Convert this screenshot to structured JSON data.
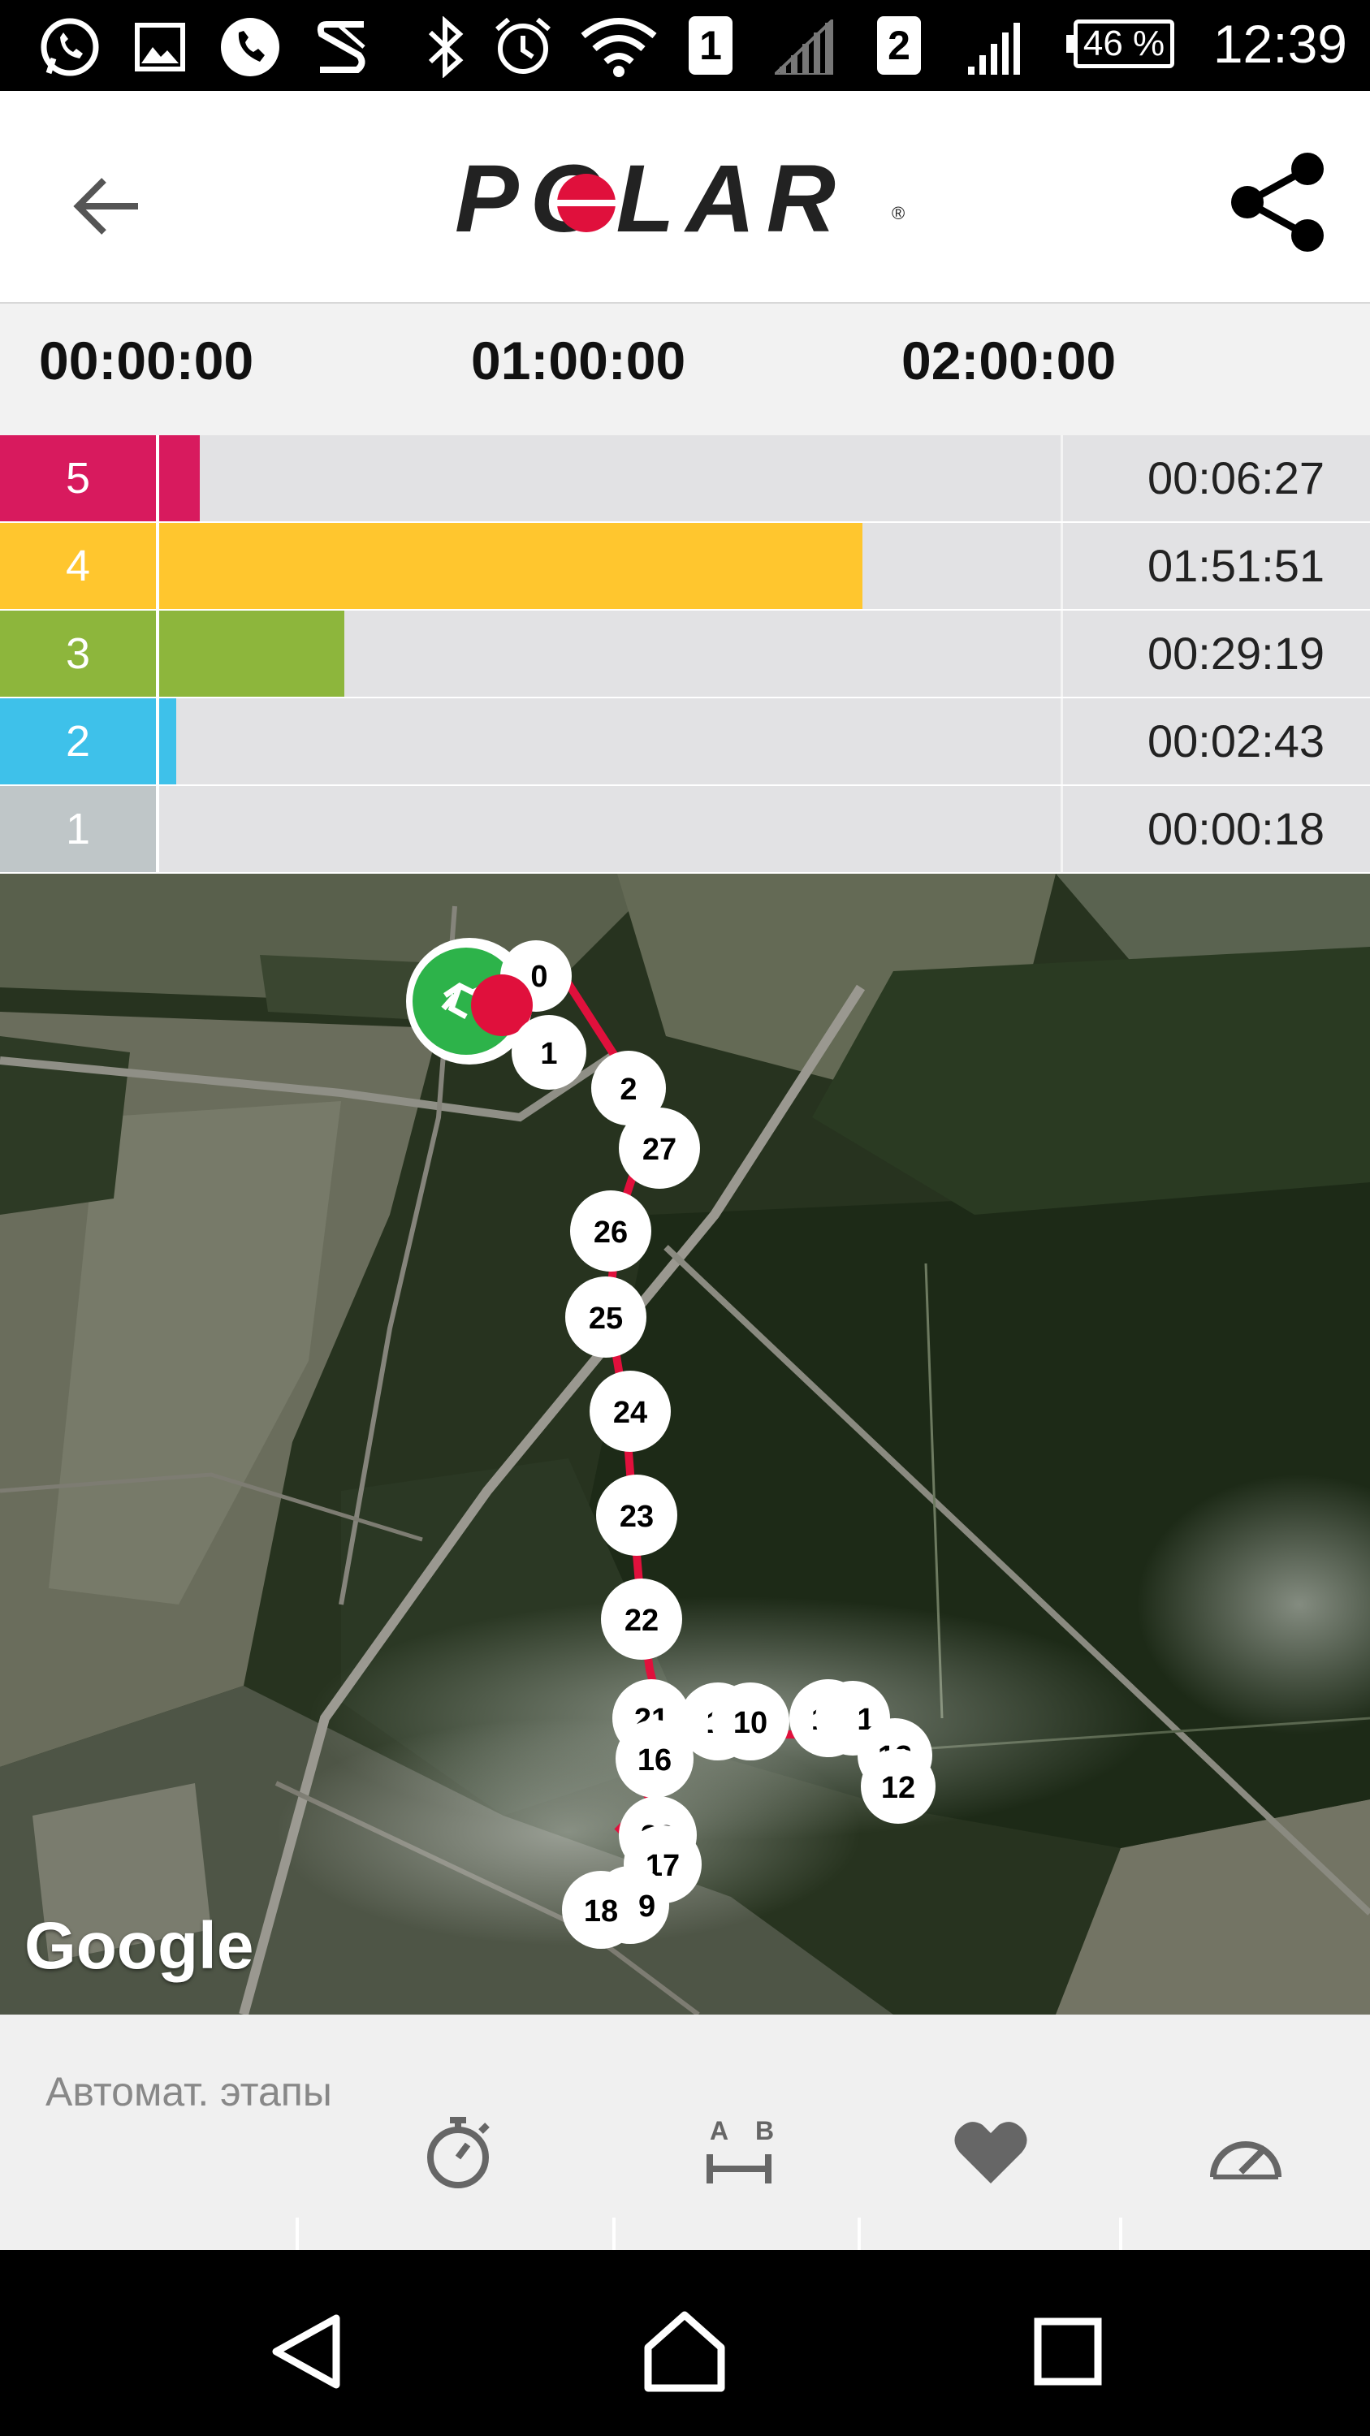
{
  "status_bar": {
    "time": "12:39",
    "battery": "46 %",
    "sim1": "1",
    "sim2": "2",
    "icons": [
      "whatsapp-icon",
      "gallery-icon",
      "phone-icon",
      "s-app-icon",
      "bluetooth-icon",
      "alarm-icon",
      "wifi-icon",
      "signal-icon",
      "signal-icon",
      "battery-icon"
    ]
  },
  "header": {
    "logo_text": "POLAR",
    "logo_reg": "®",
    "back_icon": "arrow-left-icon",
    "share_icon": "share-icon"
  },
  "time_axis": {
    "ticks": [
      "00:00:00",
      "01:00:00",
      "02:00:00"
    ]
  },
  "zones": [
    {
      "zone": "5",
      "time": "00:06:27",
      "fraction": 0.045,
      "color": "#D81A5E"
    },
    {
      "zone": "4",
      "time": "01:51:51",
      "fraction": 0.78,
      "color": "#FFC62E"
    },
    {
      "zone": "3",
      "time": "00:29:19",
      "fraction": 0.205,
      "color": "#8DB63C"
    },
    {
      "zone": "2",
      "time": "00:02:43",
      "fraction": 0.019,
      "color": "#3EC1EA"
    },
    {
      "zone": "1",
      "time": "00:00:18",
      "fraction": 0.0,
      "color": "#BFC6C8"
    }
  ],
  "map": {
    "attribution": "Google",
    "start_icon": "running-icon",
    "markers": [
      "0",
      "1",
      "2",
      "27",
      "26",
      "25",
      "24",
      "23",
      "22",
      "21",
      "16",
      "1",
      "10",
      "14",
      "1",
      "12",
      "20",
      "17",
      "18",
      "9"
    ]
  },
  "bottom": {
    "laps_title": "Автомат. этапы",
    "tabs": [
      "stopwatch-icon",
      "distance-ab-icon",
      "heart-icon",
      "speedometer-icon"
    ]
  },
  "nav": [
    "back-icon",
    "home-icon",
    "recents-icon"
  ],
  "colors": {
    "route": "#E0103C",
    "map_dark": "#1f2a1c"
  }
}
